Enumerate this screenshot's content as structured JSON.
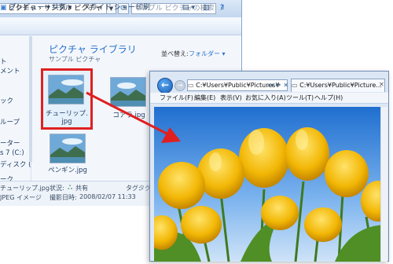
{
  "explorer": {
    "address_path": "« ピクチャ › サンプル ピクチャ",
    "search_placeholder": "サンプル ピクチャの検索",
    "toolbar": {
      "preview": "プレビュー ▾",
      "share": "共有 ▾",
      "slideshow": "スライド ショー",
      "print": "印刷"
    },
    "nav_items": [
      "ト",
      "メント",
      "ック",
      "ループ",
      "ーター",
      "s 7 (C:)",
      "ディスク (C",
      "ーク"
    ],
    "library_title": "ピクチャ ライブラリ",
    "library_subtitle": "サンプル ピクチャ",
    "arrange_label": "並べ替え:",
    "arrange_value": "フォルダー ▾",
    "files": [
      {
        "name_line1": "チューリップ.",
        "name_line2": "jpg",
        "selected": true
      },
      {
        "name_line1": "コアラ.jpg",
        "name_line2": "",
        "selected": false
      },
      {
        "name_line1": "ペンギン.jpg",
        "name_line2": "",
        "selected": false
      }
    ],
    "status": {
      "filename": "チューリップ.jpg",
      "type": "JPEG イメージ",
      "state_label": "状況:",
      "state_value": "共有",
      "date_label": "撮影日時:",
      "date_value": "2008/02/07 11:33",
      "tag_label": "タグ:",
      "tag_value": "タグ"
    }
  },
  "ie": {
    "address": "C:¥Users¥Public¥Pictures¥",
    "tab_title": "C:¥Users¥Public¥Picture...",
    "menu": [
      "ファイル(F)",
      "編集(E)",
      "表示(V)",
      "お気に入り(A)",
      "ツール(T)",
      "ヘルプ(H)"
    ]
  },
  "colors": {
    "highlight": "#e02020",
    "accent": "#2a70c8",
    "tulip": "#f0b800"
  }
}
